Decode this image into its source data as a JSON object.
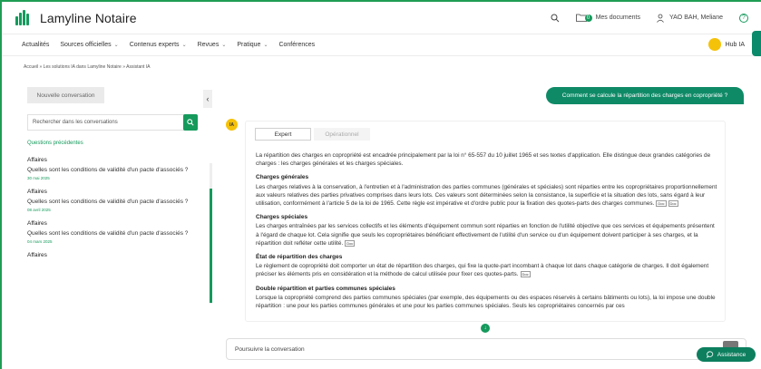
{
  "header": {
    "brand": "Lamyline Notaire",
    "my_docs": "Mes documents",
    "docs_count": "0",
    "user": "YAO BAH, Meliane"
  },
  "nav": {
    "items": [
      {
        "label": "Actualités",
        "dropdown": false
      },
      {
        "label": "Sources officielles",
        "dropdown": true
      },
      {
        "label": "Contenus experts",
        "dropdown": true
      },
      {
        "label": "Revues",
        "dropdown": true
      },
      {
        "label": "Pratique",
        "dropdown": true
      },
      {
        "label": "Conférences",
        "dropdown": false
      }
    ],
    "hub": "Hub IA"
  },
  "breadcrumb": "Accueil » Les solutions IA dans Lamyline Notaire » Assistant IA",
  "sidebar": {
    "new_conversation": "Nouvelle conversation",
    "search_placeholder": "Rechercher dans les conversations",
    "section_title": "Questions précédentes",
    "conversations": [
      {
        "category": "Affaires",
        "question": "Quelles sont les conditions de validité d'un pacte d'associés ?",
        "date": "30 mai 2025"
      },
      {
        "category": "Affaires",
        "question": "Quelles sont les conditions de validité d'un pacte d'associés ?",
        "date": "08 avril 2025"
      },
      {
        "category": "Affaires",
        "question": "Quelles sont les conditions de validité d'un pacte d'associés ?",
        "date": "04 mars 2025"
      },
      {
        "category": "Affaires",
        "question": "",
        "date": ""
      }
    ]
  },
  "chat": {
    "user_question": "Comment se calcule la répartition des charges en copropriété ?",
    "avatar": "IA",
    "tabs": {
      "expert": "Expert",
      "operational": "Opérationnel"
    },
    "intro": "La répartition des charges en copropriété est encadrée principalement par la loi n° 65-557 du 10 juillet 1965 et ses textes d'application. Elle distingue deux grandes catégories de charges : les charges générales et les charges spéciales.",
    "ref_label": "Doc",
    "sections": [
      {
        "title": "Charges générales",
        "text": "Les charges relatives à la conservation, à l'entretien et à l'administration des parties communes (générales et spéciales) sont réparties entre les copropriétaires proportionnellement aux valeurs relatives des parties privatives comprises dans leurs lots. Ces valeurs sont déterminées selon la consistance, la superficie et la situation des lots, sans égard à leur utilisation, conformément à l'article 5 de la loi de 1965. Cette règle est impérative et d'ordre public pour la fixation des quotes-parts des charges communes."
      },
      {
        "title": "Charges spéciales",
        "text": "Les charges entraînées par les services collectifs et les éléments d'équipement commun sont réparties en fonction de l'utilité objective que ces services et équipements présentent à l'égard de chaque lot. Cela signifie que seuls les copropriétaires bénéficiant effectivement de l'utilité d'un service ou d'un équipement doivent participer à ses charges, et la répartition doit refléter cette utilité."
      },
      {
        "title": "État de répartition des charges",
        "text": "Le règlement de copropriété doit comporter un état de répartition des charges, qui fixe la quote-part incombant à chaque lot dans chaque catégorie de charges. Il doit également préciser les éléments pris en considération et la méthode de calcul utilisée pour fixer ces quotes-parts."
      },
      {
        "title": "Double répartition et parties communes spéciales",
        "text": "Lorsque la copropriété comprend des parties communes spéciales (par exemple, des équipements ou des espaces réservés à certains bâtiments ou lots), la loi impose une double répartition : une pour les parties communes générales et une pour les parties communes spéciales. Seuls les copropriétaires concernés par ces"
      }
    ],
    "input_placeholder": "Poursuivre la conversation",
    "assistance": "Assistance"
  },
  "colors": {
    "brand_green": "#159a5c",
    "accent_yellow": "#f5c20a",
    "bubble": "#0f8a67"
  }
}
